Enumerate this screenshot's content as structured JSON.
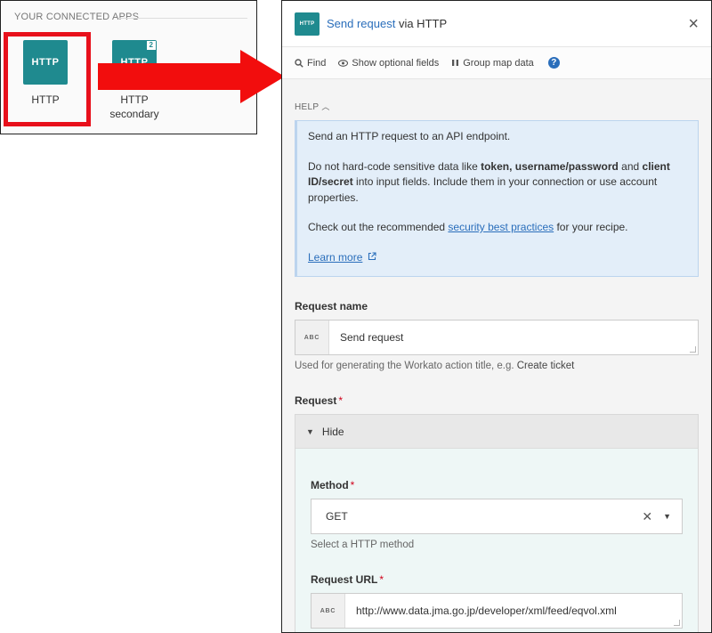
{
  "apps": {
    "heading": "YOUR CONNECTED APPS",
    "items": [
      {
        "logo_text": "HTTP",
        "name": "HTTP",
        "badge": ""
      },
      {
        "logo_text": "HTTP",
        "name": "HTTP\nsecondary",
        "badge": "2"
      }
    ]
  },
  "panel": {
    "logo_text": "HTTP",
    "title_prefix": "Send request",
    "title_suffix": " via HTTP",
    "close": "×"
  },
  "toolbar": {
    "find": "Find",
    "optional": "Show optional fields",
    "group": "Group map data",
    "help": "?"
  },
  "help": {
    "toggle": "HELP",
    "p1": "Send an HTTP request to an API endpoint.",
    "p2_a": "Do not hard-code sensitive data like ",
    "p2_b": "token, username/password",
    "p2_c": " and ",
    "p2_d": "client ID/secret",
    "p2_e": " into input fields. Include them in your connection or use account properties.",
    "p3_a": "Check out the recommended ",
    "p3_link": "security best practices",
    "p3_b": " for your recipe.",
    "learn_more": "Learn more"
  },
  "request_name": {
    "label": "Request name",
    "type": "ABC",
    "value": "Send request",
    "hint_a": "Used for generating the Workato action title, e.g. ",
    "hint_b": "Create ticket"
  },
  "request": {
    "label": "Request",
    "required": "*",
    "toggle": "Hide",
    "method_label": "Method",
    "method_value": "GET",
    "method_hint": "Select a HTTP method",
    "url_label": "Request URL",
    "url_type": "ABC",
    "url_value": "http://www.data.jma.go.jp/developer/xml/feed/eqvol.xml"
  },
  "colors": {
    "app_teal": "#1f8a8f",
    "highlight_red": "#e8101b",
    "link_blue": "#2a6ebb",
    "help_bg": "#e3eef9"
  }
}
